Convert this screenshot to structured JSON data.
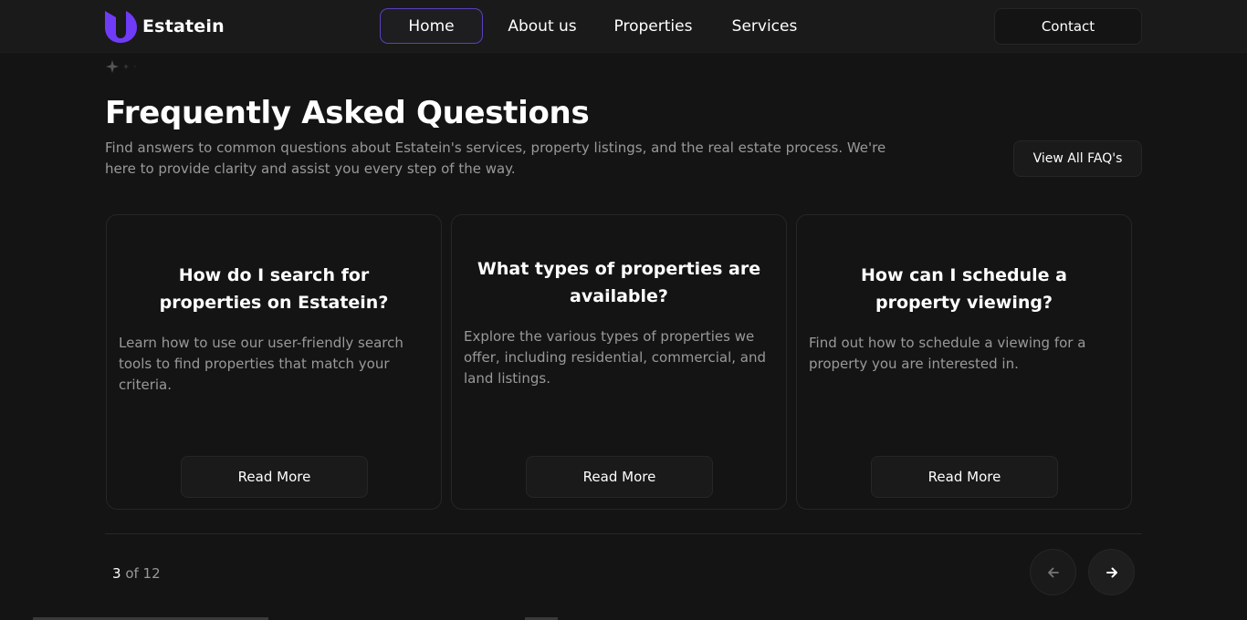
{
  "brand": {
    "name": "Estatein",
    "accent": "#703BF7"
  },
  "nav": {
    "items": [
      {
        "label": "Home",
        "active": true
      },
      {
        "label": "About us",
        "active": false
      },
      {
        "label": "Properties",
        "active": false
      },
      {
        "label": "Services",
        "active": false
      }
    ],
    "contact_label": "Contact"
  },
  "faq": {
    "title": "Frequently Asked Questions",
    "subtitle": "Find answers to common questions about Estatein's services, property listings, and the real estate process. We're here to provide clarity and assist you every step of the way.",
    "view_all_label": "View All FAQ's",
    "cards": [
      {
        "question": "How do I search for properties on Estatein?",
        "answer": "Learn how to use our user-friendly search tools to find properties that match your criteria.",
        "button": "Read More"
      },
      {
        "question": "What types of properties are available?",
        "answer": "Explore the various types of properties we offer, including residential, commercial, and land listings.",
        "button": "Read More"
      },
      {
        "question": "How can I schedule a property viewing?",
        "answer": "Find out how to schedule a viewing for a property you are interested in.",
        "button": "Read More"
      }
    ]
  },
  "pagination": {
    "current": "3",
    "separator": " of ",
    "total": "12"
  },
  "icons": {
    "logo": "estatein-logo-icon",
    "sparkles": "sparkles-icon",
    "prev": "arrow-left-icon",
    "next": "arrow-right-icon"
  }
}
